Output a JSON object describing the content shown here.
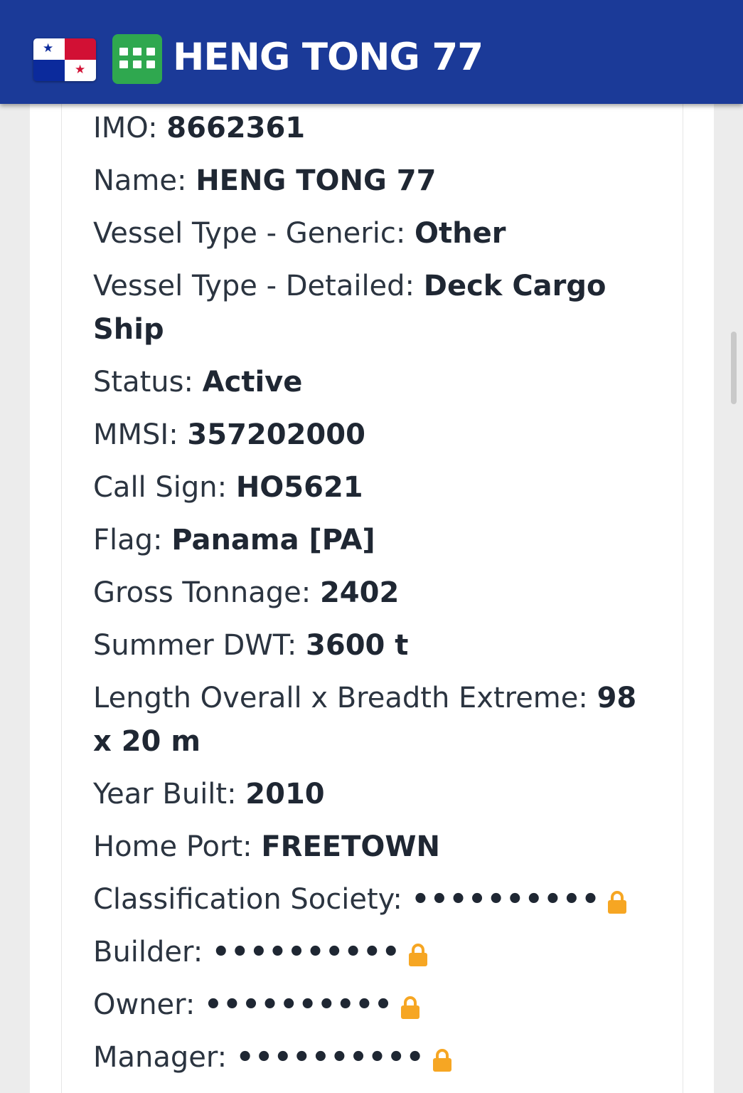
{
  "header": {
    "title": "HENG TONG 77",
    "flag_icon": "panama-flag-icon",
    "app_icon": "grid-icon",
    "colors": {
      "bar": "#1b3a98",
      "app_icon_bg": "#2fa84f"
    }
  },
  "details": [
    {
      "label": "IMO: ",
      "value": "8662361"
    },
    {
      "label": "Name: ",
      "value": "HENG TONG 77"
    },
    {
      "label": "Vessel Type - Generic: ",
      "value": "Other"
    },
    {
      "label": "Vessel Type - Detailed: ",
      "value": "Deck Cargo Ship"
    },
    {
      "label": "Status: ",
      "value": "Active"
    },
    {
      "label": "MMSI: ",
      "value": "357202000"
    },
    {
      "label": "Call Sign: ",
      "value": "HO5621"
    },
    {
      "label": "Flag: ",
      "value": "Panama [PA]"
    },
    {
      "label": "Gross Tonnage: ",
      "value": "2402"
    },
    {
      "label": "Summer DWT: ",
      "value": "3600 t"
    },
    {
      "label": "Length Overall x Breadth Extreme: ",
      "value": "98 x 20 m"
    },
    {
      "label": "Year Built: ",
      "value": "2010"
    },
    {
      "label": "Home Port: ",
      "value": "FREETOWN"
    }
  ],
  "locked_details": [
    {
      "label": "Classification Society: ",
      "masked": "••••••••••",
      "icon": "lock-icon"
    },
    {
      "label": "Builder: ",
      "masked": "••••••••••",
      "icon": "lock-icon"
    },
    {
      "label": "Owner: ",
      "masked": "••••••••••",
      "icon": "lock-icon"
    },
    {
      "label": "Manager: ",
      "masked": "••••••••••",
      "icon": "lock-icon"
    }
  ],
  "colors": {
    "lock": "#f6a623",
    "text": "#2b3440"
  }
}
